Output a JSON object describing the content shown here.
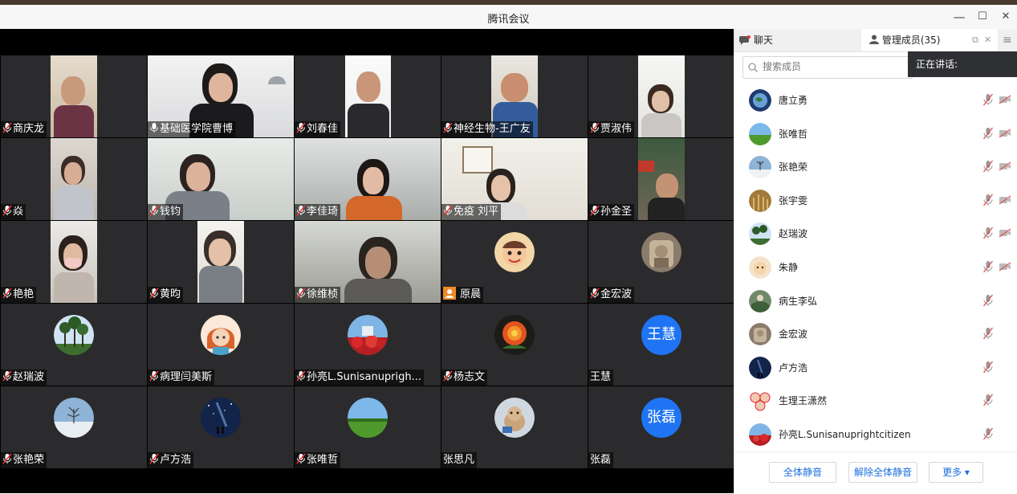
{
  "window": {
    "title": "腾讯会议",
    "minimize": "—",
    "maximize": "☐",
    "close": "✕"
  },
  "tiles": [
    "商庆龙",
    "基础医学院曹博",
    "刘春佳",
    "神经生物-王广友",
    "贾淑伟",
    "焱",
    "钱钧",
    "李佳琦",
    "免疫 刘平",
    "孙金圣",
    "艳艳",
    "黄昀",
    "徐维桢",
    "原晨",
    "金宏波",
    "赵瑞波",
    "病理闫美斯",
    "孙亮L.Sunisanuprigh...",
    "杨志文",
    "王慧",
    "张艳荣",
    "卢方浩",
    "张唯哲",
    "张思凡",
    "张磊"
  ],
  "tile_avatar_text": {
    "wanghui": "王慧",
    "zhanglei": "张磊"
  },
  "panel": {
    "chat_tab": "聊天",
    "members_tab": "管理成员(35)",
    "search_placeholder": "搜索成员",
    "speaking_label": "正在讲话:",
    "members": [
      "唐立勇",
      "张唯哲",
      "张艳荣",
      "张宇雯",
      "赵瑞波",
      "朱静",
      "病生李弘",
      "金宏波",
      "卢方浩",
      "生理王潇然",
      "孙亮L.Sunisanuprightcitizen"
    ],
    "mute_all": "全体静音",
    "unmute_all": "解除全体静音",
    "more": "更多 ▾"
  },
  "colors": {
    "accent": "#1e74f2",
    "stage": "#000000",
    "tile": "#2b2b2d"
  }
}
